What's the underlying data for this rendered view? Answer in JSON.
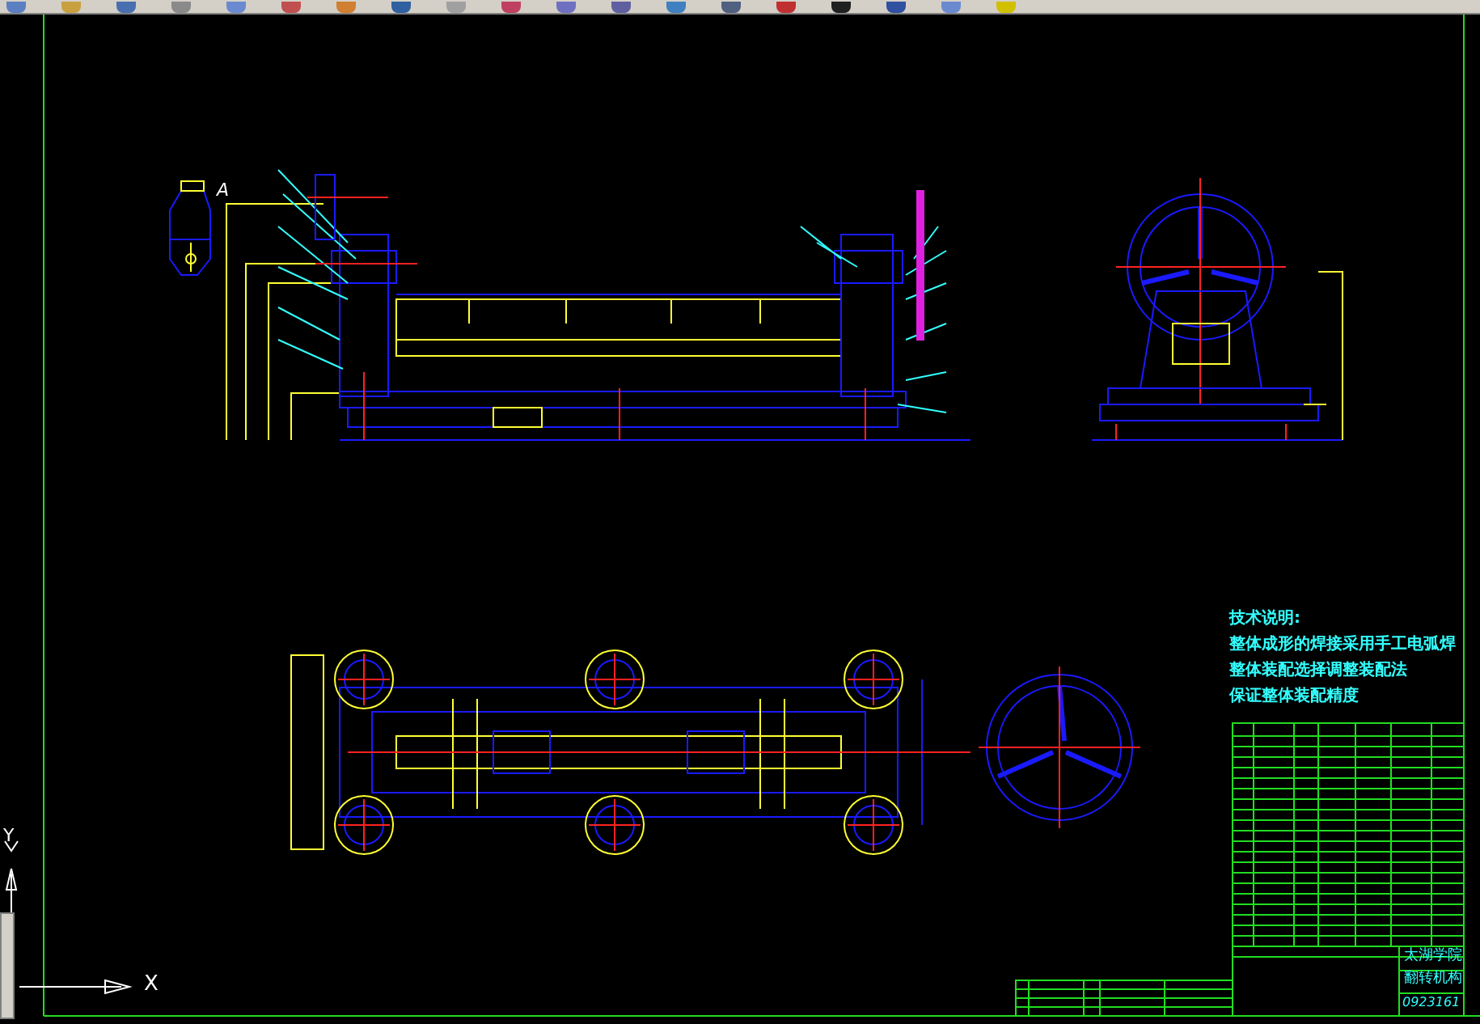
{
  "view_label": "A",
  "ucs": {
    "x_label": "X",
    "y_label": "Y"
  },
  "notes": {
    "title": "技术说明:",
    "lines": [
      "整体成形的焊接采用手工电弧焊",
      "整体装配选择调整装配法",
      "保证整体装配精度"
    ]
  },
  "title_block": {
    "school": "太湖学院",
    "drawing_name": "翻转机构",
    "drawing_number": "0923161"
  }
}
